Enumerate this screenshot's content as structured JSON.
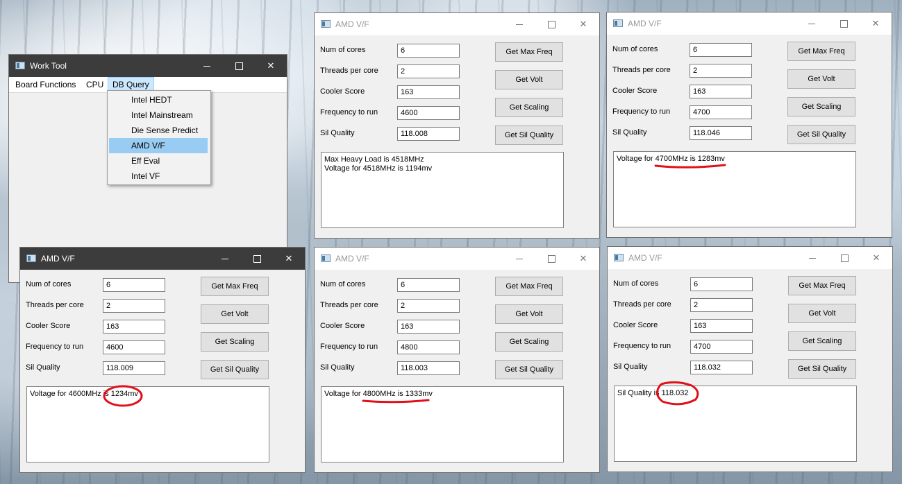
{
  "work_tool": {
    "title": "Work Tool",
    "menu": [
      "Board Functions",
      "CPU",
      "DB Query"
    ],
    "dropdown": [
      "Intel HEDT",
      "Intel Mainstream",
      "Die Sense Predict",
      "AMD V/F",
      "Eff Eval",
      "Intel VF"
    ],
    "selected_dropdown": "AMD V/F"
  },
  "labels": {
    "cores": "Num of cores",
    "threads": "Threads per core",
    "cooler": "Cooler Score",
    "freq": "Frequency to run",
    "sil": "Sil Quality"
  },
  "buttons": {
    "max_freq": "Get Max Freq",
    "volt": "Get Volt",
    "scaling": "Get Scaling",
    "sil_quality": "Get Sil Quality"
  },
  "icons": {
    "minimize": "minimize-icon",
    "maximize": "maximize-icon",
    "close": "close-icon",
    "app": "app-icon"
  },
  "windows": [
    {
      "title": "AMD V/F",
      "cores": "6",
      "threads": "2",
      "cooler": "163",
      "freq": "4600",
      "sil": "118.008",
      "output": [
        "Max Heavy Load is 4518MHz",
        "Voltage for 4518MHz is 1194mv"
      ]
    },
    {
      "title": "AMD V/F",
      "cores": "6",
      "threads": "2",
      "cooler": "163",
      "freq": "4700",
      "sil": "118.046",
      "output": [
        "Voltage for 4700MHz is 1283mv"
      ]
    },
    {
      "title": "AMD V/F",
      "cores": "6",
      "threads": "2",
      "cooler": "163",
      "freq": "4600",
      "sil": "118.009",
      "output": [
        "Voltage for 4600MHz is 1234mv"
      ]
    },
    {
      "title": "AMD V/F",
      "cores": "6",
      "threads": "2",
      "cooler": "163",
      "freq": "4800",
      "sil": "118.003",
      "output": [
        "Voltage for 4800MHz is 1333mv"
      ]
    },
    {
      "title": "AMD V/F",
      "cores": "6",
      "threads": "2",
      "cooler": "163",
      "freq": "4700",
      "sil": "118.032",
      "output": [
        "Sil Quality is 118.032"
      ]
    }
  ],
  "annotation_color": "#e0101a"
}
